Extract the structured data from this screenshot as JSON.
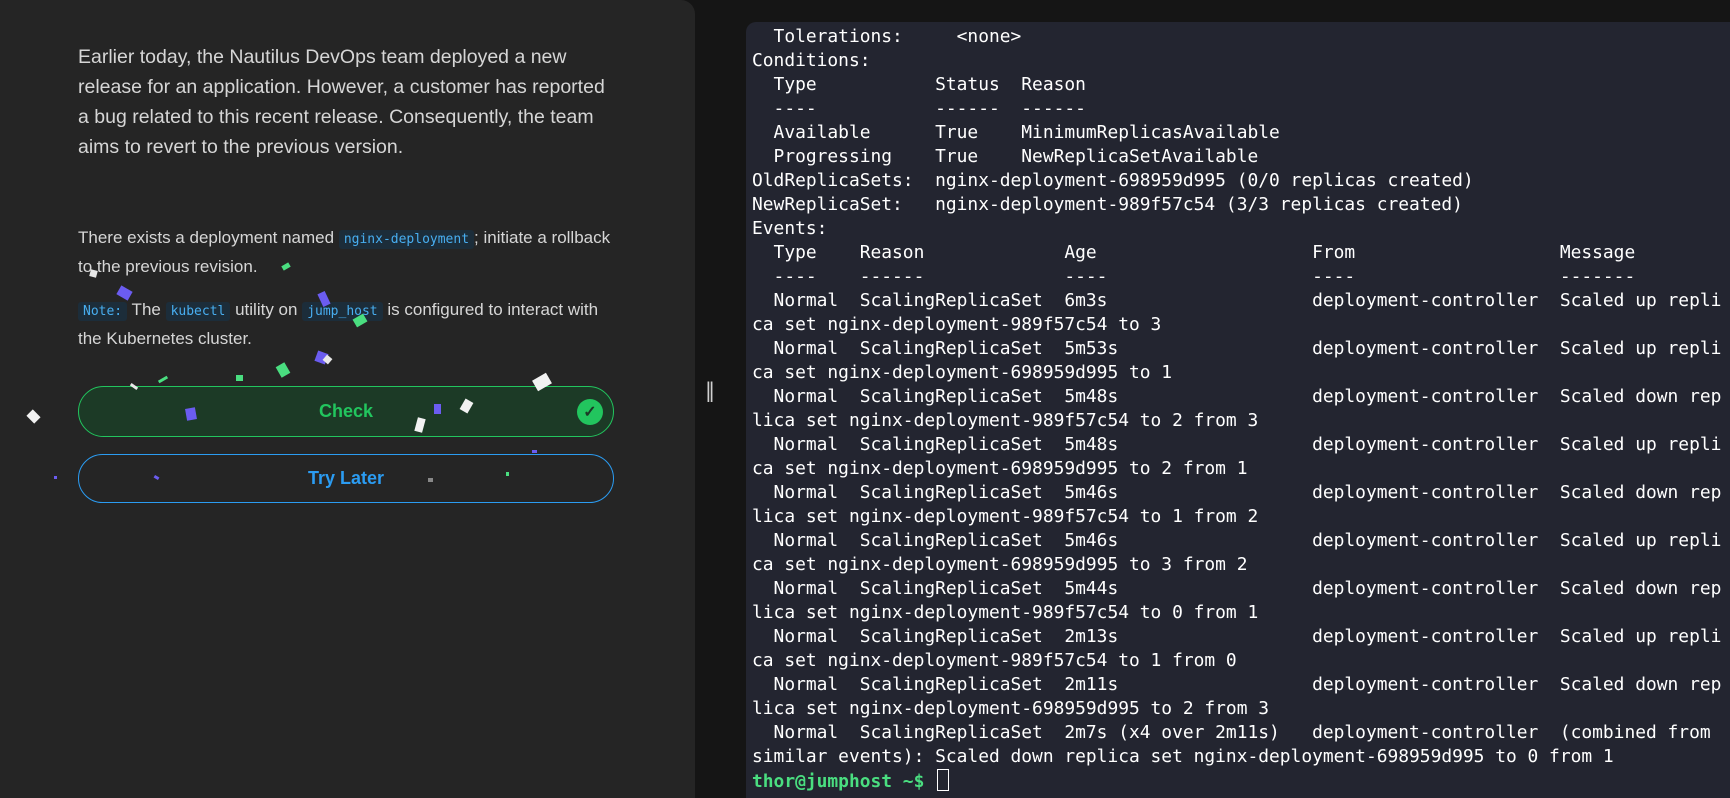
{
  "task": {
    "para1": "Earlier today, the Nautilus DevOps team deployed a new release for an application. However, a customer has reported a bug related to this recent release. Consequently, the team aims to revert to the previous version.",
    "para2_before": "There exists a deployment named ",
    "para2_code": "nginx-deployment",
    "para2_after": "; initiate a rollback to the previous revision.",
    "note_label": "Note:",
    "note_the": " The ",
    "note_code1": "kubectl",
    "note_middle": " utility on ",
    "note_code2": "jump_host",
    "note_after": " is configured to interact with the Kubernetes cluster."
  },
  "buttons": {
    "check_label": "Check",
    "try_later_label": "Try Later"
  },
  "splitter": {
    "glyph": "‖"
  },
  "icons": {
    "check_icon": "check-circle-icon",
    "check_glyph": "✓"
  },
  "colors": {
    "check_green": "#22c55e",
    "link_blue": "#2b9cf2",
    "prompt_green": "#4ade80",
    "terminal_bg": "#232530",
    "panel_bg": "#252525"
  },
  "terminal": {
    "lines": [
      "  Tolerations:     <none>",
      "Conditions:",
      "  Type           Status  Reason",
      "  ----           ------  ------",
      "  Available      True    MinimumReplicasAvailable",
      "  Progressing    True    NewReplicaSetAvailable",
      "OldReplicaSets:  nginx-deployment-698959d995 (0/0 replicas created)",
      "NewReplicaSet:   nginx-deployment-989f57c54 (3/3 replicas created)",
      "Events:",
      "  Type    Reason             Age                    From                   Message",
      "  ----    ------             ----                   ----                   -------",
      "  Normal  ScalingReplicaSet  6m3s                   deployment-controller  Scaled up repli",
      "ca set nginx-deployment-989f57c54 to 3",
      "  Normal  ScalingReplicaSet  5m53s                  deployment-controller  Scaled up repli",
      "ca set nginx-deployment-698959d995 to 1",
      "  Normal  ScalingReplicaSet  5m48s                  deployment-controller  Scaled down rep",
      "lica set nginx-deployment-989f57c54 to 2 from 3",
      "  Normal  ScalingReplicaSet  5m48s                  deployment-controller  Scaled up repli",
      "ca set nginx-deployment-698959d995 to 2 from 1",
      "  Normal  ScalingReplicaSet  5m46s                  deployment-controller  Scaled down rep",
      "lica set nginx-deployment-989f57c54 to 1 from 2",
      "  Normal  ScalingReplicaSet  5m46s                  deployment-controller  Scaled up repli",
      "ca set nginx-deployment-698959d995 to 3 from 2",
      "  Normal  ScalingReplicaSet  5m44s                  deployment-controller  Scaled down rep",
      "lica set nginx-deployment-989f57c54 to 0 from 1",
      "  Normal  ScalingReplicaSet  2m13s                  deployment-controller  Scaled up repli",
      "ca set nginx-deployment-989f57c54 to 1 from 0",
      "  Normal  ScalingReplicaSet  2m11s                  deployment-controller  Scaled down rep",
      "lica set nginx-deployment-698959d995 to 2 from 3",
      "  Normal  ScalingReplicaSet  2m7s (x4 over 2m11s)   deployment-controller  (combined from",
      "similar events): Scaled down replica set nginx-deployment-698959d995 to 0 from 1"
    ],
    "prompt": "thor@jumphost ~$ "
  }
}
